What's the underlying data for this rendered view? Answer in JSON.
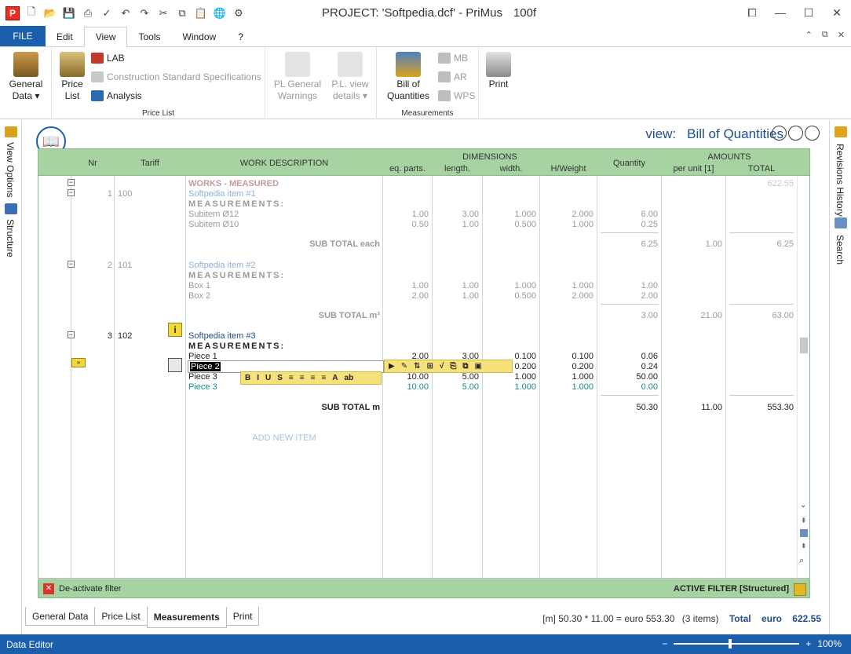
{
  "window": {
    "title": "PROJECT: 'Softpedia.dcf' - PriMus",
    "version": "100f",
    "logo": "P"
  },
  "menu": {
    "file": "FILE",
    "items": [
      "Edit",
      "View",
      "Tools",
      "Window",
      "?"
    ]
  },
  "ribbon": {
    "general_data": "General Data ▾",
    "price_list": "Price List",
    "lab": "LAB",
    "construction": "Construction Standard Specifications",
    "analysis": "Analysis",
    "group_price_list": "Price List",
    "pl_general_warnings": "PL General Warnings",
    "pl_view_details": "P.L. view details ▾",
    "bill_of_quantities": "Bill of Quantities",
    "mb": "MB",
    "ar": "AR",
    "wps": "WPS",
    "group_measurements": "Measurements",
    "print": "Print"
  },
  "side": {
    "left_tabs": [
      "View Options",
      "Structure"
    ],
    "right_tabs": [
      "Revisions History",
      "Search"
    ]
  },
  "view": {
    "label": "view:",
    "name": "Bill of Quantities"
  },
  "grid": {
    "headers": {
      "nr": "Nr",
      "tariff": "Tariff",
      "work_description": "WORK DESCRIPTION",
      "dimensions": "DIMENSIONS",
      "eq_parts": "eq. parts.",
      "length": "length.",
      "width": "width.",
      "hweight": "H/Weight",
      "quantity": "Quantity",
      "amounts": "AMOUNTS",
      "per_unit": "per unit [1]",
      "total": "TOTAL"
    },
    "section": {
      "label": "WORKS - MEASURED",
      "total": "622.55"
    },
    "measurements_label": "MEASUREMENTS:",
    "items": [
      {
        "nr": "1",
        "tariff": "100",
        "name": "Softpedia item #1",
        "rows": [
          {
            "desc": "Subitem Ø12",
            "eq": "1.00",
            "len": "3.00",
            "wid": "1.000",
            "hw": "2.000",
            "qty": "6.00"
          },
          {
            "desc": "Subitem Ø10",
            "eq": "0.50",
            "len": "1.00",
            "wid": "0.500",
            "hw": "1.000",
            "qty": "0.25"
          }
        ],
        "subtotal_label": "SUB TOTAL each",
        "subtotal_qty": "6.25",
        "unit": "1.00",
        "total": "6.25"
      },
      {
        "nr": "2",
        "tariff": "101",
        "name": "Softpedia item #2",
        "rows": [
          {
            "desc": "Box 1",
            "eq": "1.00",
            "len": "1.00",
            "wid": "1.000",
            "hw": "1.000",
            "qty": "1.00"
          },
          {
            "desc": "Box 2",
            "eq": "2.00",
            "len": "1.00",
            "wid": "0.500",
            "hw": "2.000",
            "qty": "2.00"
          }
        ],
        "subtotal_label": "SUB TOTAL m³",
        "subtotal_qty": "3.00",
        "unit": "21.00",
        "total": "63.00"
      },
      {
        "nr": "3",
        "tariff": "102",
        "name": "Softpedia item #3",
        "rows": [
          {
            "desc": "Piece 1",
            "eq": "2.00",
            "len": "3.00",
            "wid": "0.100",
            "hw": "0.100",
            "qty": "0.06"
          },
          {
            "desc": "Piece 2",
            "eq": "",
            "len": "",
            "wid": "0.200",
            "hw": "0.200",
            "qty": "0.24"
          },
          {
            "desc": "Piece 3",
            "eq": "10.00",
            "len": "5.00",
            "wid": "1.000",
            "hw": "1.000",
            "qty": "50.00"
          },
          {
            "desc": "Piece 3",
            "eq": "10.00",
            "len": "5.00",
            "wid": "1.000",
            "hw": "1.000",
            "qty": "0.00"
          }
        ],
        "subtotal_label": "SUB TOTAL m",
        "subtotal_qty": "50.30",
        "unit": "11.00",
        "total": "553.30"
      }
    ],
    "add_new_item": "ADD NEW ITEM",
    "edit_value": "Piece 2",
    "format_buttons": [
      "B",
      "I",
      "U",
      "S",
      "≡",
      "≡",
      "≡",
      "≡",
      "A",
      "ab"
    ]
  },
  "filter": {
    "deactivate": "De-activate filter",
    "active": "ACTIVE FILTER [Structured]"
  },
  "bottom_tabs": [
    "General Data",
    "Price List",
    "Measurements",
    "Print"
  ],
  "totals": {
    "formula": "[m] 50.30 * 11.00 = euro 553.30",
    "items": "(3 items)",
    "label": "Total",
    "currency": "euro",
    "value": "622.55"
  },
  "status": {
    "left": "Data Editor",
    "zoom": "100%"
  },
  "colors": {
    "brand": "#1b5eab",
    "grid_header": "#a7d3a3"
  }
}
